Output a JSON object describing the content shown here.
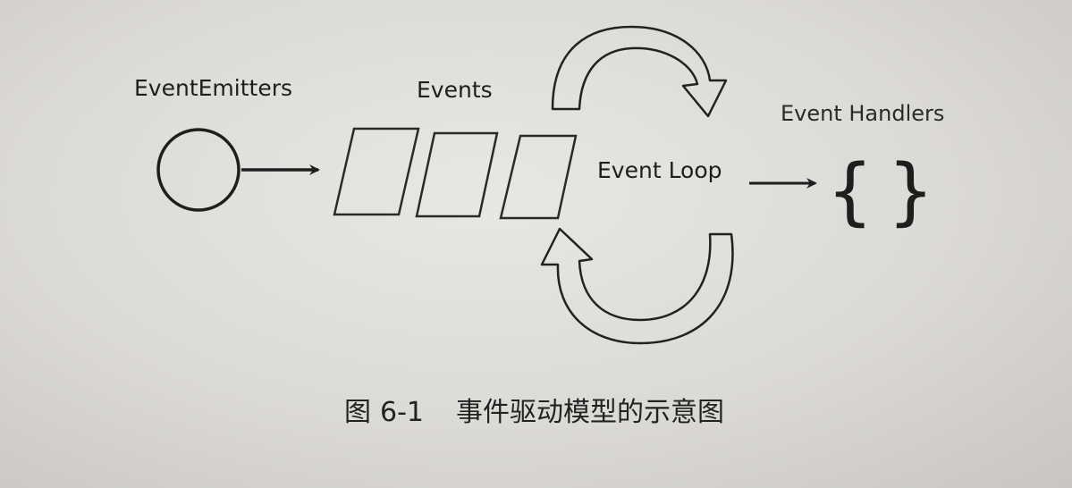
{
  "labels": {
    "emitters": "EventEmitters",
    "events": "Events",
    "loop": "Event Loop",
    "handlers": "Event Handlers"
  },
  "handlers_braces": {
    "open": "{",
    "close": "}"
  },
  "caption": {
    "prefix": "图",
    "number": "6-1",
    "text": "事件驱动模型的示意图"
  },
  "colors": {
    "stroke": "#1e1e1e",
    "paper": "#e3e1dd"
  }
}
